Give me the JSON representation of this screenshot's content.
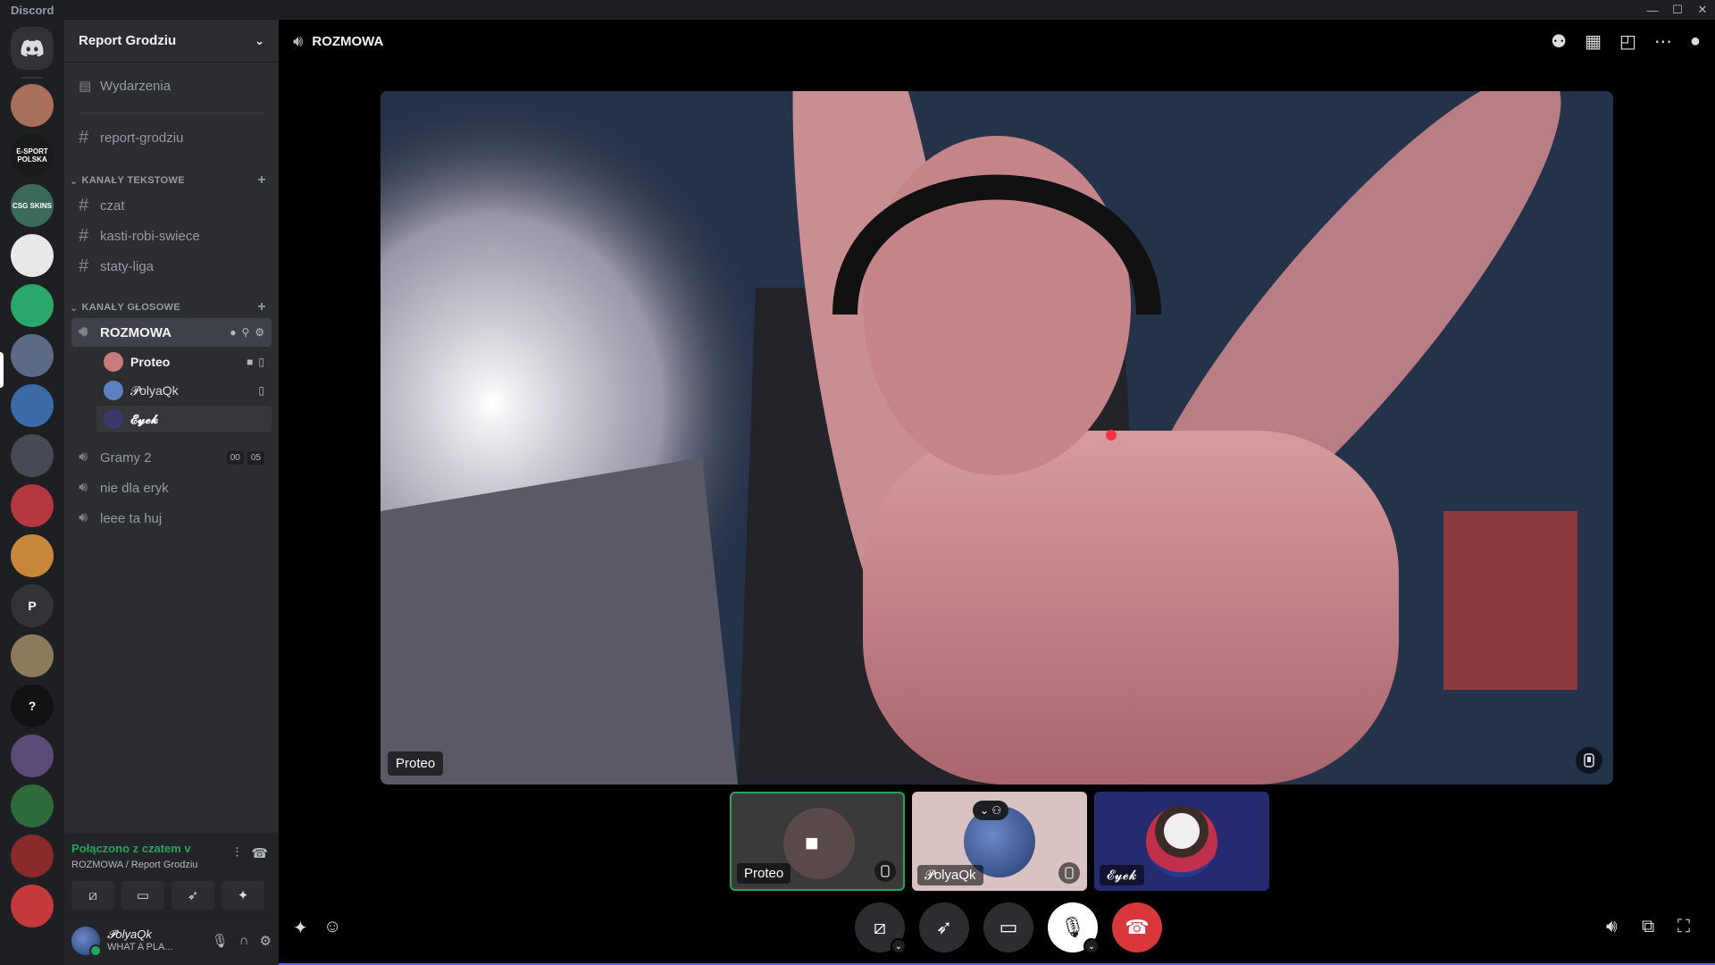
{
  "app": {
    "title": "Discord"
  },
  "window": {
    "minimize": "—",
    "maximize": "☐",
    "close": "✕"
  },
  "guilds": [
    {
      "label": "",
      "color": "#a8705a"
    },
    {
      "label": "E-SPORT POLSKA",
      "color": "#1a1a1a"
    },
    {
      "label": "CSG SKINS",
      "color": "#3a6b5a"
    },
    {
      "label": "",
      "color": "#e8e8e8"
    },
    {
      "label": "",
      "color": "#2aa86a"
    },
    {
      "label": "",
      "color": "#5b6b86"
    },
    {
      "label": "",
      "color": "#3c6aa8"
    },
    {
      "label": "",
      "color": "#474a55"
    },
    {
      "label": "",
      "color": "#b3383f"
    },
    {
      "label": "",
      "color": "#c8863a"
    },
    {
      "label": "P",
      "color": "#313338"
    },
    {
      "label": "",
      "color": "#8c7b5b"
    },
    {
      "label": "?",
      "color": "#111"
    },
    {
      "label": "",
      "color": "#5a4b78"
    },
    {
      "label": "",
      "color": "#2f6a3a"
    },
    {
      "label": "",
      "color": "#8a2a2a"
    },
    {
      "label": "",
      "color": "#c43a3a"
    }
  ],
  "server": {
    "name": "Report Grodziu",
    "events": "Wydarzenia",
    "top_channel": "report-grodziu",
    "text_category": "KANAŁY TEKSTOWE",
    "text_channels": [
      "czat",
      "kasti-robi-swiece",
      "staty-liga"
    ],
    "voice_category": "KANAŁY GŁOSOWE",
    "active_voice": "ROZMOWA",
    "voice_users": [
      {
        "name": "Proteo",
        "color": "#c77b7b"
      },
      {
        "name": "𝓟olyaQk",
        "color": "#5f7fc0"
      },
      {
        "name": "𝓔𝔂𝓮𝓴",
        "color": "#3a3a6a"
      }
    ],
    "other_voice": [
      {
        "name": "Gramy 2",
        "t1": "00",
        "t2": "05"
      },
      {
        "name": "nie dla eryk"
      },
      {
        "name": "leee ta huj"
      }
    ]
  },
  "voice_panel": {
    "status": "Połączono z czatem v",
    "sub": "ROZMOWA / Report Grodziu"
  },
  "user": {
    "name": "𝓟olyaQk",
    "status": "WHAT A PLA..."
  },
  "main": {
    "channel_title": "ROZMOWA",
    "stage_label": "Proteo",
    "tiles": [
      {
        "name": "Proteo",
        "bg": "#3a3a3a"
      },
      {
        "name": "𝓟olyaQk",
        "bg": "#d8c2c2"
      },
      {
        "name": "𝓔𝔂𝓮𝓴",
        "bg": "#262a6e"
      }
    ]
  },
  "colors": {
    "accent": "#5865f2",
    "green": "#23a55a",
    "red": "#da373c"
  }
}
